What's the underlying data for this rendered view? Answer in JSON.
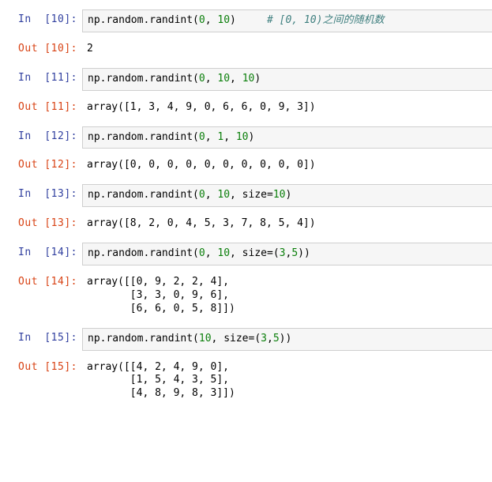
{
  "cells": [
    {
      "n": 10,
      "in_tokens": [
        {
          "t": "np.random.randint(",
          "c": "tok-fn"
        },
        {
          "t": "0",
          "c": "tok-num"
        },
        {
          "t": ", "
        },
        {
          "t": "10",
          "c": "tok-num"
        },
        {
          "t": ")     "
        },
        {
          "t": "# [0, 10)之间的随机数",
          "c": "tok-cmt"
        }
      ],
      "out": "2"
    },
    {
      "n": 11,
      "in_tokens": [
        {
          "t": "np.random.randint(",
          "c": "tok-fn"
        },
        {
          "t": "0",
          "c": "tok-num"
        },
        {
          "t": ", "
        },
        {
          "t": "10",
          "c": "tok-num"
        },
        {
          "t": ", "
        },
        {
          "t": "10",
          "c": "tok-num"
        },
        {
          "t": ")"
        }
      ],
      "out": "array([1, 3, 4, 9, 0, 6, 6, 0, 9, 3])"
    },
    {
      "n": 12,
      "in_tokens": [
        {
          "t": "np.random.randint(",
          "c": "tok-fn"
        },
        {
          "t": "0",
          "c": "tok-num"
        },
        {
          "t": ", "
        },
        {
          "t": "1",
          "c": "tok-num"
        },
        {
          "t": ", "
        },
        {
          "t": "10",
          "c": "tok-num"
        },
        {
          "t": ")"
        }
      ],
      "out": "array([0, 0, 0, 0, 0, 0, 0, 0, 0, 0])"
    },
    {
      "n": 13,
      "in_tokens": [
        {
          "t": "np.random.randint(",
          "c": "tok-fn"
        },
        {
          "t": "0",
          "c": "tok-num"
        },
        {
          "t": ", "
        },
        {
          "t": "10",
          "c": "tok-num"
        },
        {
          "t": ", size="
        },
        {
          "t": "10",
          "c": "tok-num"
        },
        {
          "t": ")"
        }
      ],
      "out": "array([8, 2, 0, 4, 5, 3, 7, 8, 5, 4])"
    },
    {
      "n": 14,
      "in_tokens": [
        {
          "t": "np.random.randint(",
          "c": "tok-fn"
        },
        {
          "t": "0",
          "c": "tok-num"
        },
        {
          "t": ", "
        },
        {
          "t": "10",
          "c": "tok-num"
        },
        {
          "t": ", size=("
        },
        {
          "t": "3",
          "c": "tok-num"
        },
        {
          "t": ","
        },
        {
          "t": "5",
          "c": "tok-num"
        },
        {
          "t": "))"
        }
      ],
      "out": "array([[0, 9, 2, 2, 4],\n       [3, 3, 0, 9, 6],\n       [6, 6, 0, 5, 8]])"
    },
    {
      "n": 15,
      "in_tokens": [
        {
          "t": "np.random.randint(",
          "c": "tok-fn"
        },
        {
          "t": "10",
          "c": "tok-num"
        },
        {
          "t": ", size=("
        },
        {
          "t": "3",
          "c": "tok-num"
        },
        {
          "t": ","
        },
        {
          "t": "5",
          "c": "tok-num"
        },
        {
          "t": "))"
        }
      ],
      "out": "array([[4, 2, 4, 9, 0],\n       [1, 5, 4, 3, 5],\n       [4, 8, 9, 8, 3]])"
    }
  ]
}
